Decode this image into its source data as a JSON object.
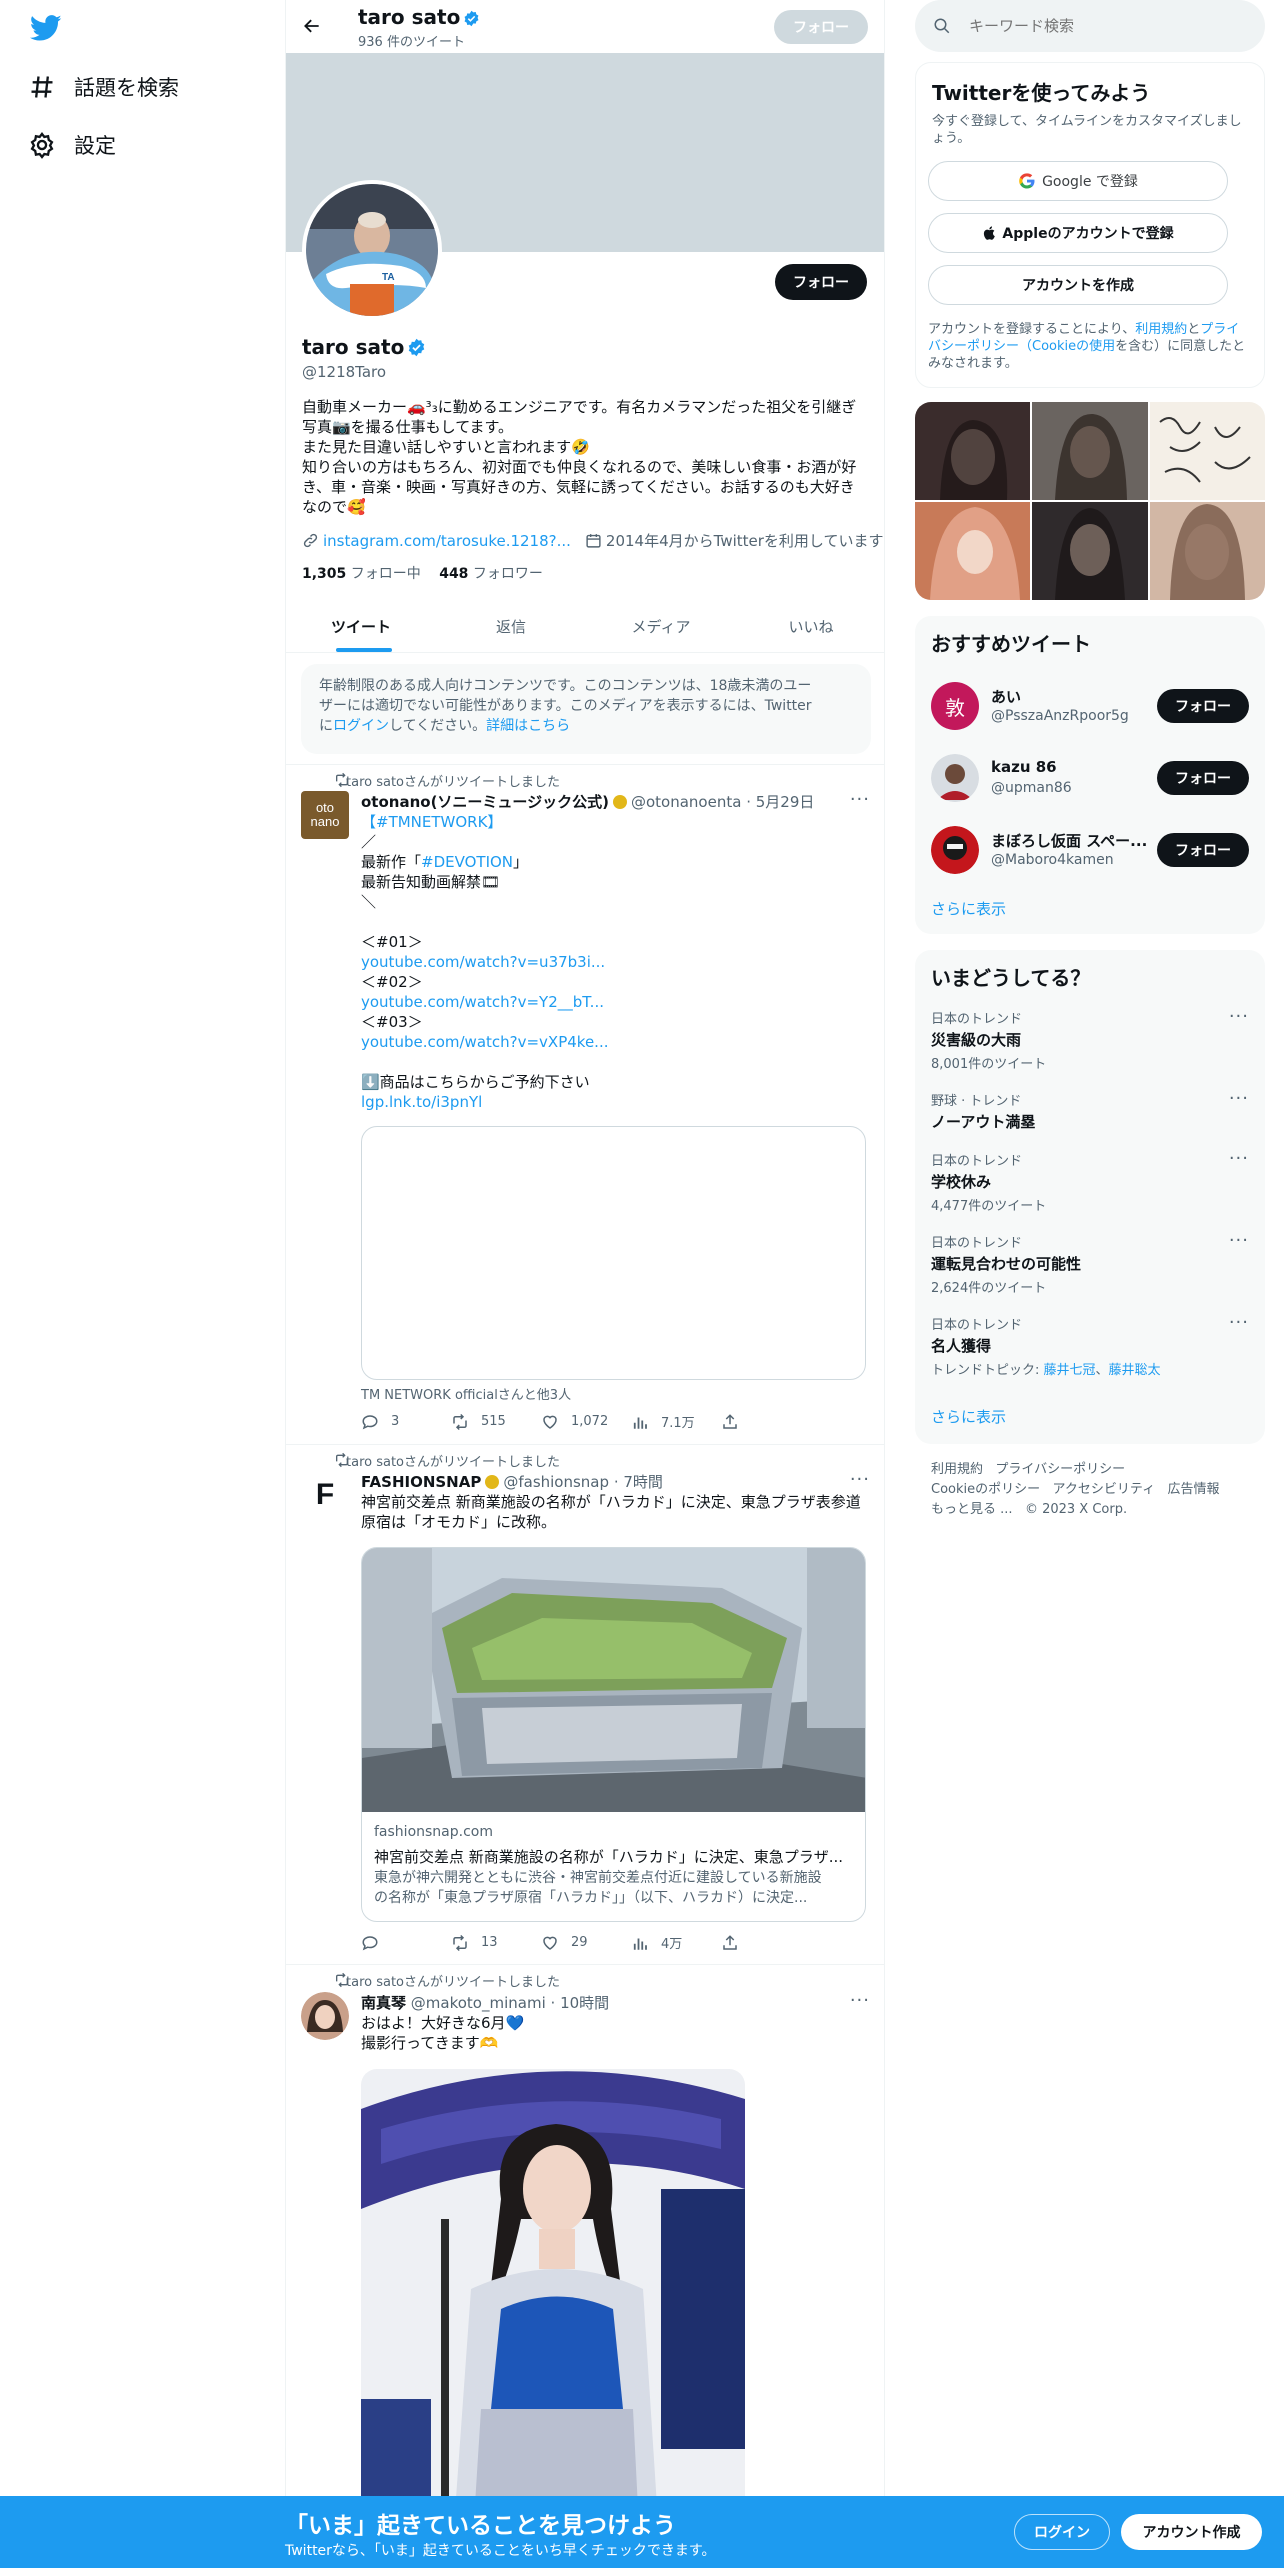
{
  "nav": {
    "explore": "話題を検索",
    "settings": "設定"
  },
  "header": {
    "name": "taro sato",
    "tweet_count": "936 件のツイート",
    "follow": "フォロー"
  },
  "profile": {
    "name": "taro sato",
    "handle": "@1218Taro",
    "bio_1": "自動車メーカー🚗³₃に勤めるエンジニアです。有名カメラマンだった祖父を引継ぎ",
    "bio_2": "写真📷を撮る仕事もしてます。",
    "bio_3": "また見た目違い話しやすいと言われます🤣",
    "bio_4": "知り合いの方はもちろん、初対面でも仲良くなれるので、美味しい食事・お酒が好",
    "bio_5": "き、車・音楽・映画・写真好きの方、気軽に誘ってください。お話するのも大好き",
    "bio_6": "なので🥰",
    "link": "instagram.com/tarosuke.1218?...",
    "joined": "2014年4月からTwitterを利用しています",
    "following_count": "1,305",
    "following_label": "フォロー中",
    "followers_count": "448",
    "followers_label": "フォロワー",
    "follow": "フォロー"
  },
  "tabs": [
    "ツイート",
    "返信",
    "メディア",
    "いいね"
  ],
  "notice": {
    "line1": "年齢制限のある成人向けコンテンツです。このコンテンツは、18歳未満のユー",
    "line2": "ザーには適切でない可能性があります。このメディアを表示するには、Twitter",
    "line3_pre": "に",
    "login": "ログイン",
    "line3_mid": "してください。",
    "details": "詳細はこちら"
  },
  "tweets": [
    {
      "retweet": "taro satoさんがリツイートしました",
      "name": "otonano(ソニーミュージック公式)",
      "handle": "@otonanoenta",
      "time": "· 5月29日",
      "hashtag1": "【#TMNETWORK】",
      "l2": "／",
      "l3_pre": "最新作「",
      "hashtag2": "#DEVOTION",
      "l3_post": "」",
      "l4": "最新告知動画解禁🎞",
      "l5": "＼",
      "l6": "＜#01＞",
      "url1": "youtube.com/watch?v=u37b3i...",
      "l7": "＜#02＞",
      "url2": "youtube.com/watch?v=Y2__bT...",
      "l8": "＜#03＞",
      "url3": "youtube.com/watch?v=vXP4ke...",
      "l9": "⬇️商品はこちらからご予約下さい",
      "url4": "lgp.lnk.to/i3pnYl",
      "tagged": "TM NETWORK officialさんと他3人",
      "replies": "3",
      "retweets": "515",
      "likes": "1,072",
      "views": "7.1万"
    },
    {
      "retweet": "taro satoさんがリツイートしました",
      "name": "FASHIONSNAP",
      "handle": "@fashionsnap",
      "time": "· 7時間",
      "l1": "神宮前交差点 新商業施設の名称が「ハラカド」に決定、東急プラザ表参道",
      "l2": "原宿は「オモカド」に改称。",
      "card_domain": "fashionsnap.com",
      "card_title": "神宮前交差点 新商業施設の名称が「ハラカド」に決定、東急プラザ...",
      "card_desc1": "東急が神六開発とともに渋谷・神宮前交差点付近に建設している新施設",
      "card_desc2": "の名称が「東急プラザ原宿「ハラカド」」（以下、ハラカド）に決定...",
      "replies": "",
      "retweets": "13",
      "likes": "29",
      "views": "4万"
    },
    {
      "retweet": "taro satoさんがリツイートしました",
      "name": "南真琴",
      "handle": "@makoto_minami",
      "time": "· 10時間",
      "l1": "おはよ！大好きな6月💙",
      "l2": "撮影行ってきます🫶"
    }
  ],
  "search": {
    "placeholder": "キーワード検索"
  },
  "signup": {
    "title": "Twitterを使ってみよう",
    "sub": "今すぐ登録して、タイムラインをカスタマイズしましょう。",
    "google": "Google で登録",
    "apple": "Appleのアカウントで登録",
    "create": "アカウントを作成",
    "terms_1": "アカウントを登録することにより、",
    "terms_link1": "利用規約",
    "terms_2": "と",
    "terms_link2": "プライバシーポリシー（Cookieの使用",
    "terms_3": "を含む）に同意したとみなされます。"
  },
  "recommended": {
    "title": "おすすめツイート",
    "users": [
      {
        "name": "あい",
        "handle": "@PsszaAnzRpoor5g",
        "initial": "敦",
        "follow": "フォロー"
      },
      {
        "name": "kazu 86",
        "handle": "@upman86",
        "initial": "",
        "follow": "フォロー"
      },
      {
        "name": "まぼろし仮面 スペー...",
        "handle": "@Maboro4kamen",
        "initial": "",
        "follow": "フォロー"
      }
    ],
    "more": "さらに表示"
  },
  "trends": {
    "title": "いまどうしてる？",
    "items": [
      {
        "cat": "日本のトレンド",
        "name": "災害級の大雨",
        "cnt": "8,001件のツイート"
      },
      {
        "cat": "野球 · トレンド",
        "name": "ノーアウト満塁",
        "cnt": ""
      },
      {
        "cat": "日本のトレンド",
        "name": "学校休み",
        "cnt": "4,477件のツイート"
      },
      {
        "cat": "日本のトレンド",
        "name": "運転見合わせの可能性",
        "cnt": "2,624件のツイート"
      },
      {
        "cat": "日本のトレンド",
        "name": "名人獲得",
        "cnt": ""
      }
    ],
    "topics_label": "トレンドトピック: ",
    "topic1": "藤井七冠",
    "topic_sep": "、",
    "topic2": "藤井聡太",
    "more": "さらに表示"
  },
  "footer": {
    "terms": "利用規約",
    "privacy": "プライバシーポリシー",
    "cookie": "Cookieのポリシー",
    "access": "アクセシビリティ",
    "ads": "広告情報",
    "more": "もっと見る ...",
    "copy": "© 2023 X Corp."
  },
  "bottom": {
    "title": "「いま」起きていることを見つけよう",
    "sub": "Twitterなら、「いま」起きていることをいち早くチェックできます。",
    "login": "ログイン",
    "signup": "アカウント作成"
  },
  "colors": {
    "accent": "#1d9bf0",
    "text": "#0f1419",
    "muted": "#536471"
  }
}
